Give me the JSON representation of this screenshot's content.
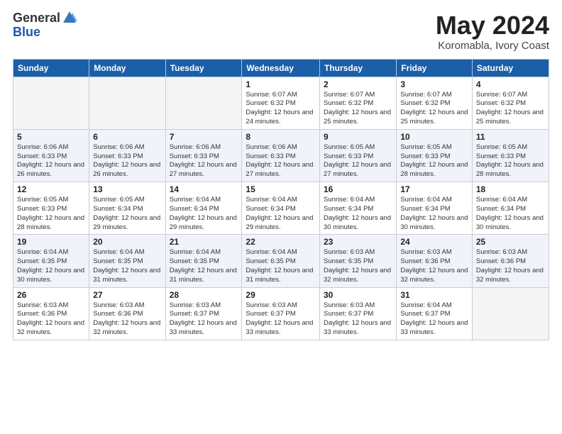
{
  "header": {
    "logo_general": "General",
    "logo_blue": "Blue",
    "month_title": "May 2024",
    "subtitle": "Koromabla, Ivory Coast"
  },
  "days_of_week": [
    "Sunday",
    "Monday",
    "Tuesday",
    "Wednesday",
    "Thursday",
    "Friday",
    "Saturday"
  ],
  "weeks": [
    [
      {
        "day": "",
        "info": ""
      },
      {
        "day": "",
        "info": ""
      },
      {
        "day": "",
        "info": ""
      },
      {
        "day": "1",
        "info": "Sunrise: 6:07 AM\nSunset: 6:32 PM\nDaylight: 12 hours\nand 24 minutes."
      },
      {
        "day": "2",
        "info": "Sunrise: 6:07 AM\nSunset: 6:32 PM\nDaylight: 12 hours\nand 25 minutes."
      },
      {
        "day": "3",
        "info": "Sunrise: 6:07 AM\nSunset: 6:32 PM\nDaylight: 12 hours\nand 25 minutes."
      },
      {
        "day": "4",
        "info": "Sunrise: 6:07 AM\nSunset: 6:32 PM\nDaylight: 12 hours\nand 25 minutes."
      }
    ],
    [
      {
        "day": "5",
        "info": "Sunrise: 6:06 AM\nSunset: 6:33 PM\nDaylight: 12 hours\nand 26 minutes."
      },
      {
        "day": "6",
        "info": "Sunrise: 6:06 AM\nSunset: 6:33 PM\nDaylight: 12 hours\nand 26 minutes."
      },
      {
        "day": "7",
        "info": "Sunrise: 6:06 AM\nSunset: 6:33 PM\nDaylight: 12 hours\nand 27 minutes."
      },
      {
        "day": "8",
        "info": "Sunrise: 6:06 AM\nSunset: 6:33 PM\nDaylight: 12 hours\nand 27 minutes."
      },
      {
        "day": "9",
        "info": "Sunrise: 6:05 AM\nSunset: 6:33 PM\nDaylight: 12 hours\nand 27 minutes."
      },
      {
        "day": "10",
        "info": "Sunrise: 6:05 AM\nSunset: 6:33 PM\nDaylight: 12 hours\nand 28 minutes."
      },
      {
        "day": "11",
        "info": "Sunrise: 6:05 AM\nSunset: 6:33 PM\nDaylight: 12 hours\nand 28 minutes."
      }
    ],
    [
      {
        "day": "12",
        "info": "Sunrise: 6:05 AM\nSunset: 6:33 PM\nDaylight: 12 hours\nand 28 minutes."
      },
      {
        "day": "13",
        "info": "Sunrise: 6:05 AM\nSunset: 6:34 PM\nDaylight: 12 hours\nand 29 minutes."
      },
      {
        "day": "14",
        "info": "Sunrise: 6:04 AM\nSunset: 6:34 PM\nDaylight: 12 hours\nand 29 minutes."
      },
      {
        "day": "15",
        "info": "Sunrise: 6:04 AM\nSunset: 6:34 PM\nDaylight: 12 hours\nand 29 minutes."
      },
      {
        "day": "16",
        "info": "Sunrise: 6:04 AM\nSunset: 6:34 PM\nDaylight: 12 hours\nand 30 minutes."
      },
      {
        "day": "17",
        "info": "Sunrise: 6:04 AM\nSunset: 6:34 PM\nDaylight: 12 hours\nand 30 minutes."
      },
      {
        "day": "18",
        "info": "Sunrise: 6:04 AM\nSunset: 6:34 PM\nDaylight: 12 hours\nand 30 minutes."
      }
    ],
    [
      {
        "day": "19",
        "info": "Sunrise: 6:04 AM\nSunset: 6:35 PM\nDaylight: 12 hours\nand 30 minutes."
      },
      {
        "day": "20",
        "info": "Sunrise: 6:04 AM\nSunset: 6:35 PM\nDaylight: 12 hours\nand 31 minutes."
      },
      {
        "day": "21",
        "info": "Sunrise: 6:04 AM\nSunset: 6:35 PM\nDaylight: 12 hours\nand 31 minutes."
      },
      {
        "day": "22",
        "info": "Sunrise: 6:04 AM\nSunset: 6:35 PM\nDaylight: 12 hours\nand 31 minutes."
      },
      {
        "day": "23",
        "info": "Sunrise: 6:03 AM\nSunset: 6:35 PM\nDaylight: 12 hours\nand 32 minutes."
      },
      {
        "day": "24",
        "info": "Sunrise: 6:03 AM\nSunset: 6:36 PM\nDaylight: 12 hours\nand 32 minutes."
      },
      {
        "day": "25",
        "info": "Sunrise: 6:03 AM\nSunset: 6:36 PM\nDaylight: 12 hours\nand 32 minutes."
      }
    ],
    [
      {
        "day": "26",
        "info": "Sunrise: 6:03 AM\nSunset: 6:36 PM\nDaylight: 12 hours\nand 32 minutes."
      },
      {
        "day": "27",
        "info": "Sunrise: 6:03 AM\nSunset: 6:36 PM\nDaylight: 12 hours\nand 32 minutes."
      },
      {
        "day": "28",
        "info": "Sunrise: 6:03 AM\nSunset: 6:37 PM\nDaylight: 12 hours\nand 33 minutes."
      },
      {
        "day": "29",
        "info": "Sunrise: 6:03 AM\nSunset: 6:37 PM\nDaylight: 12 hours\nand 33 minutes."
      },
      {
        "day": "30",
        "info": "Sunrise: 6:03 AM\nSunset: 6:37 PM\nDaylight: 12 hours\nand 33 minutes."
      },
      {
        "day": "31",
        "info": "Sunrise: 6:04 AM\nSunset: 6:37 PM\nDaylight: 12 hours\nand 33 minutes."
      },
      {
        "day": "",
        "info": ""
      }
    ]
  ]
}
